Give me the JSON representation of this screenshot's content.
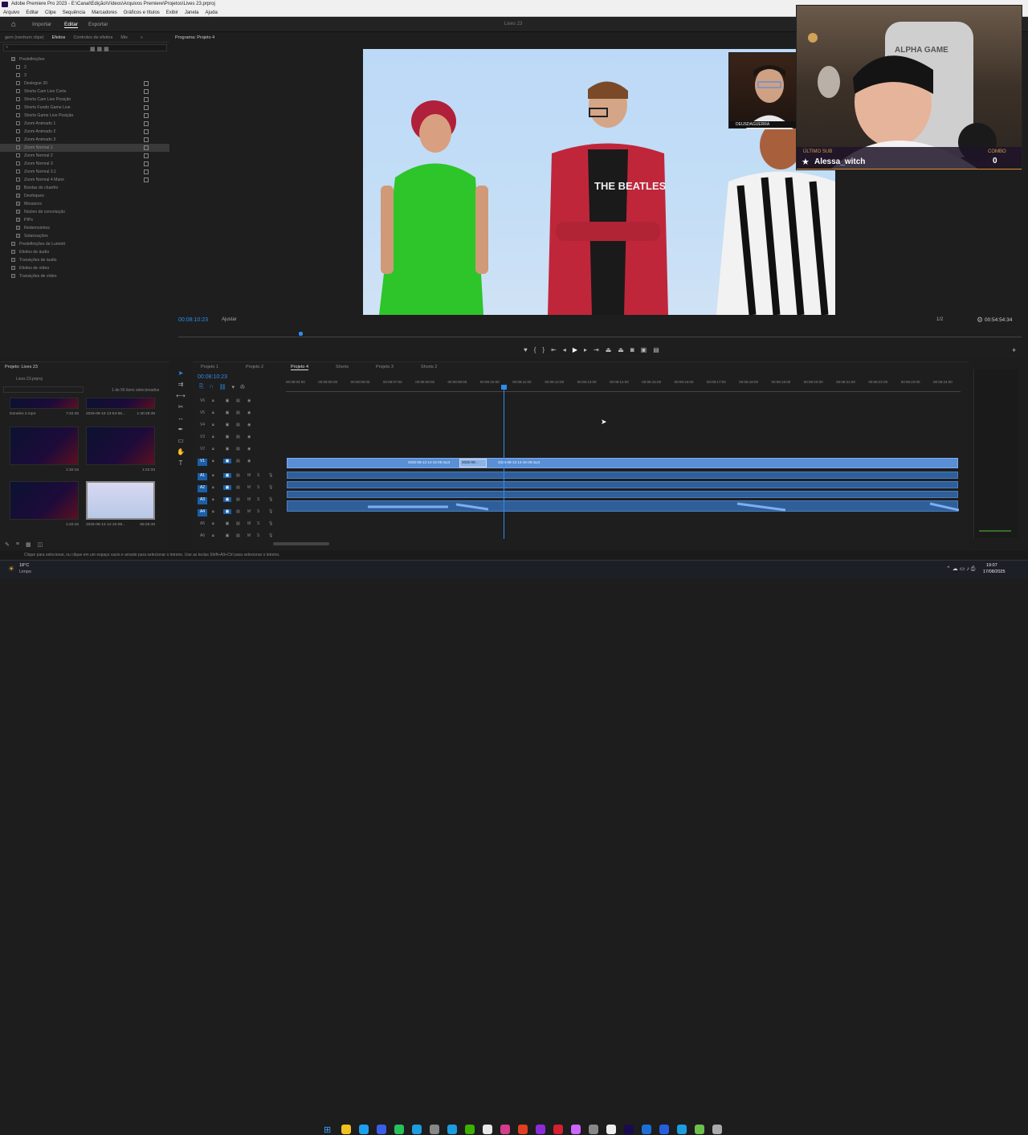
{
  "window": {
    "title": "Adobe Premiere Pro 2023 - E:\\Canal\\Edição\\Vídeos\\Arquivos Premiere\\Projetos\\Lives 23.prproj"
  },
  "menu": [
    "Arquivo",
    "Editar",
    "Clipe",
    "Sequência",
    "Marcadores",
    "Gráficos e títulos",
    "Exibir",
    "Janela",
    "Ajuda"
  ],
  "header": {
    "tabs": [
      "Importar",
      "Editar",
      "Exportar"
    ],
    "center": "Lives 23"
  },
  "effects": {
    "tabs": [
      "gem (nenhum clipe)",
      "Efeitos",
      "Controles de efeitos",
      "Mix"
    ],
    "root": "Predefinições",
    "items": [
      "2",
      "3",
      "Deslogue 20",
      "Shorts Cam Live Corte",
      "Shorts Cam Live Posição",
      "Shorts Fundo Game Live",
      "Shorts Game Live Posição",
      "Zoom Animado 1",
      "Zoom Animado 2",
      "Zoom Animado 3",
      "Zoom Normal 1",
      "Zoom Normal 2",
      "Zoom Normal 3",
      "Zoom Normal 3.1",
      "Zoom Normal 4 Maior"
    ],
    "folders": [
      "Bordas do chanfro",
      "Desfoques",
      "Mosaicos",
      "Núcleo de convolução",
      "PIPs",
      "Redemoinhos",
      "Solarizações"
    ],
    "root_folders": [
      "Predefinições de Lumetri",
      "Efeitos de áudio",
      "Transições de áudio",
      "Efeitos de vídeo",
      "Transições de vídeo"
    ]
  },
  "program": {
    "tab": "Programa: Projeto 4",
    "timecode": "00:08:10:23",
    "fit": "Ajustar",
    "quality": "1/2",
    "duration": "00:54:54:34"
  },
  "overlay": {
    "last_sub_label": "ÚLTIMO SUB",
    "last_sub_name": "Alessa_witch",
    "combo_label": "COMBO",
    "combo_value": "0",
    "cam_brand": "ALPHA GAME",
    "webcam_label": "DEUSDAGUERRA",
    "shirt_text": "THE BEATLES"
  },
  "project": {
    "title": "Projeto: Lives 23",
    "file": "Lives 23.prproj",
    "selection": "1 de 56 itens selecionados",
    "items": [
      {
        "name": "Doneles 2.mp4",
        "dur": "7:22:45"
      },
      {
        "name": "2025-08-19 13-53-55...",
        "dur": "1:40:29:48"
      },
      {
        "name": "",
        "dur": "1:32:15"
      },
      {
        "name": "",
        "dur": "1:22:33"
      },
      {
        "name": "",
        "dur": "1:22:15"
      },
      {
        "name": "2025-08-13 14-15-09...",
        "dur": "55:28:48"
      }
    ]
  },
  "timeline": {
    "tabs": [
      "Projeto 1",
      "Projeto 2",
      "Projeto 4",
      "Shorts",
      "Projeto 3",
      "Shorts 2"
    ],
    "timecode": "00:08:10:23",
    "ruler": [
      "00:08:04:00",
      "00:08:05:00",
      "00:08:06:00",
      "00:08:07:00",
      "00:08:08:00",
      "00:08:09:00",
      "00:08:10:00",
      "00:08:11:00",
      "00:08:12:00",
      "00:08:13:00",
      "00:08:14:00",
      "00:08:15:00",
      "00:08:16:00",
      "00:08:17:00",
      "00:08:18:00",
      "00:08:19:00",
      "00:08:20:00",
      "00:08:21:00",
      "00:08:22:00",
      "00:08:23:00",
      "00:08:24:00"
    ],
    "video_tracks": [
      "V6",
      "V5",
      "V4",
      "V3",
      "V2",
      "V1"
    ],
    "audio_tracks": [
      "A1",
      "A2",
      "A3",
      "A4",
      "A5",
      "A6"
    ],
    "clips": [
      "2025-08-13 14-15-09.mp4",
      "2025-08-..",
      "2025-08-13 14-15-09.mp4"
    ]
  },
  "status": {
    "hint": "Clique para selecionar, ou clique em um espaço vazio e arraste para selecionar o letreiro. Use as teclas Shift+Alt+Ctrl para selecionar o letreiro."
  },
  "taskbar": {
    "weather_temp": "18°C",
    "weather_desc": "Limpo",
    "time": "19:07",
    "date": "17/08/2025"
  },
  "colors": {
    "clip_blue": "#5a8fd6",
    "accent": "#2d8ceb",
    "selected_track": "#1b5fa8"
  }
}
